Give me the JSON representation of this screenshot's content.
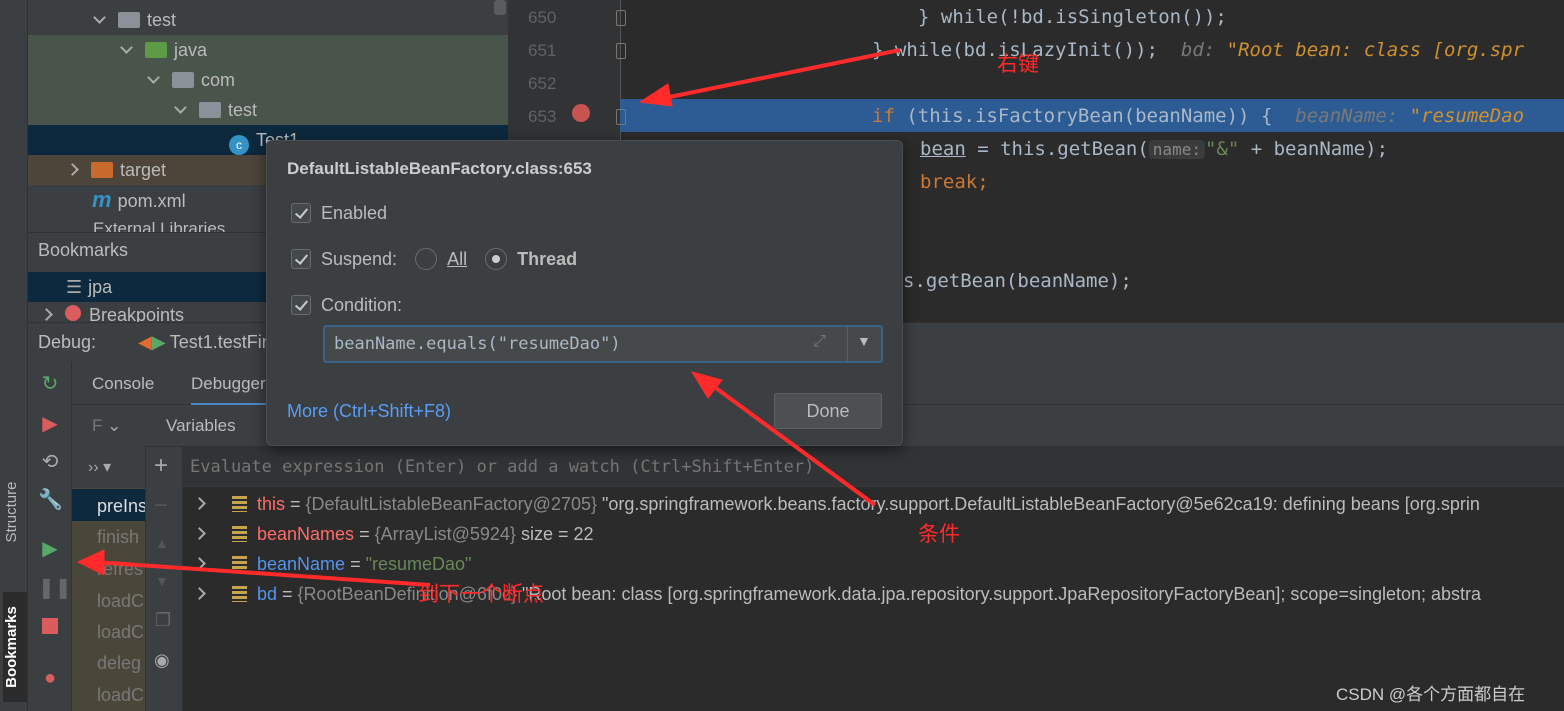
{
  "project_tree": {
    "items": [
      {
        "label": "test",
        "type": "folder"
      },
      {
        "label": "java",
        "type": "source-folder"
      },
      {
        "label": "com",
        "type": "package"
      },
      {
        "label": "test",
        "type": "package"
      },
      {
        "label": "Test1",
        "type": "class"
      },
      {
        "label": "target",
        "type": "excluded-folder"
      },
      {
        "label": "pom.xml",
        "type": "maven-file"
      },
      {
        "label": "External Libraries",
        "type": "libraries"
      }
    ]
  },
  "bookmarks": {
    "title": "Bookmarks",
    "items": [
      {
        "label": "jpa"
      },
      {
        "label": "Breakpoints"
      }
    ]
  },
  "side_tabs": {
    "structure": "Structure",
    "bookmarks": "Bookmarks"
  },
  "debug": {
    "label": "Debug:",
    "session_tab": "Test1.testFin",
    "tabs": [
      "Console",
      "Debugger"
    ],
    "frames_label": "F",
    "variables_label": "Variables",
    "evaluate_placeholder": "Evaluate expression (Enter) or add a watch (Ctrl+Shift+Enter)",
    "frames": [
      "preIns",
      "finish",
      "refres",
      "loadC",
      "loadC",
      "deleg",
      "loadC"
    ],
    "variables": [
      {
        "name": "this",
        "name_color": "#ff6b68",
        "value": "{DefaultListableBeanFactory@2705}",
        "extra": "\"org.springframework.beans.factory.support.DefaultListableBeanFactory@5e62ca19: defining beans [org.sprin"
      },
      {
        "name": "beanNames",
        "name_color": "#ff6b68",
        "value": "{ArrayList@5924}",
        "extra": "size = 22"
      },
      {
        "name": "beanName",
        "name_color": "#5394ec",
        "value": "\"resumeDao\"",
        "extra": ""
      },
      {
        "name": "bd",
        "name_color": "#5394ec",
        "value": "{RootBeanDefinition@6f0c}",
        "extra": "\"Root bean: class [org.springframework.data.jpa.repository.support.JpaRepositoryFactoryBean]; scope=singleton; abstra"
      }
    ]
  },
  "editor": {
    "line_numbers": [
      "650",
      "651",
      "652",
      "653"
    ],
    "lines": {
      "l650": "} while(!bd.isSingleton());",
      "l651_code": "} while(bd.isLazyInit());",
      "l651_hint": "bd: ",
      "l651_hint_val": "\"Root bean: class [org.spr",
      "l653_kw": "if",
      "l653_code": " (this.isFactoryBean(beanName)) {",
      "l653_hint": "beanName: ",
      "l653_hint_val": "\"resumeDao",
      "l654a": "bean",
      "l654b": " = this.getBean(",
      "l654_param": "name:",
      "l654_str": "\"&\"",
      "l654c": " + beanName);",
      "l655": "break;",
      "l658": "s.getBean(beanName);"
    }
  },
  "breakpoint_popup": {
    "title": "DefaultListableBeanFactory.class:653",
    "enabled_label": "Enabled",
    "enabled": true,
    "suspend_label": "Suspend:",
    "suspend": true,
    "suspend_options": [
      "All",
      "Thread"
    ],
    "suspend_selected": "Thread",
    "condition_label": "Condition:",
    "condition": true,
    "condition_value": "beanName.equals(\"resumeDao\")",
    "more_link": "More (Ctrl+Shift+F8)",
    "done_button": "Done"
  },
  "annotations": {
    "right_click": "右键",
    "condition": "条件",
    "next_breakpoint": "到下一个断点"
  },
  "watermark": "CSDN @各个方面都自在",
  "colors": {
    "accent": "#589df6",
    "highlight_line": "#2d5c94",
    "annotation": "#ff2a2a"
  }
}
